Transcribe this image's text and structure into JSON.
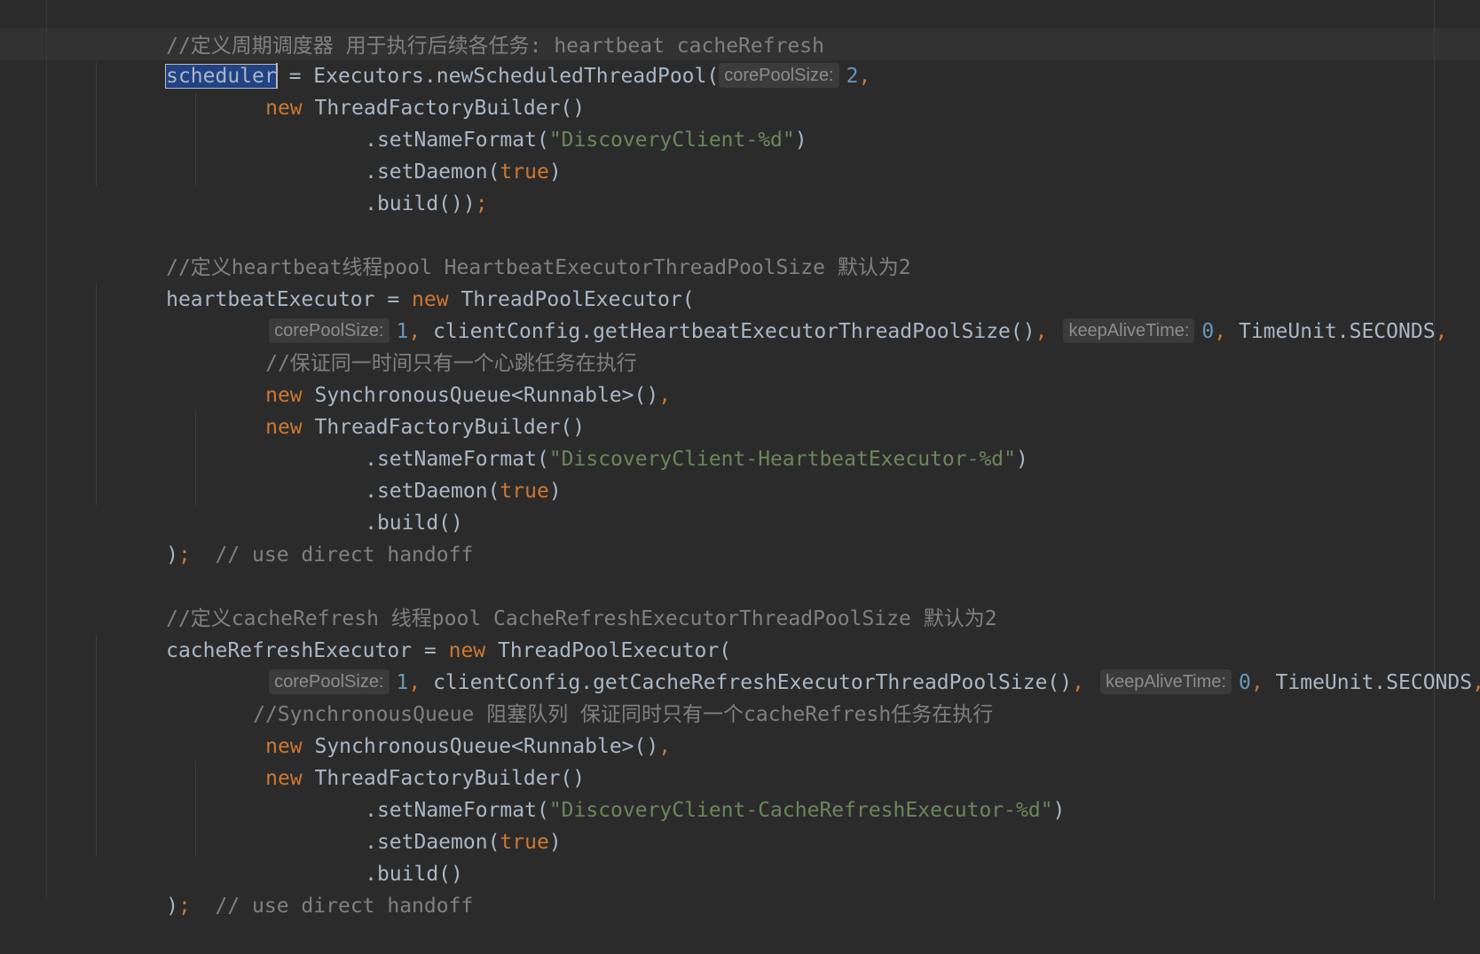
{
  "editor": {
    "lines": {
      "l1": {
        "comment": "//定义周期调度器 用于执行后续各任务: heartbeat cacheRefresh"
      },
      "l2": {
        "selected_word": "scheduler",
        "assign": " = Executors.newScheduledThreadPool(",
        "hint": "corePoolSize:",
        "arg": "2",
        "comma": ","
      },
      "l3": {
        "kw": "new",
        "text": " ThreadFactoryBuilder()"
      },
      "l4": {
        "text1": ".setNameFormat(",
        "str": "\"DiscoveryClient-%d\"",
        "text2": ")"
      },
      "l5": {
        "text1": ".setDaemon(",
        "kw": "true",
        "text2": ")"
      },
      "l6": {
        "text": ".build())",
        "semi": ";"
      },
      "l8": {
        "comment": "//定义heartbeat线程pool HeartbeatExecutorThreadPoolSize 默认为2"
      },
      "l9": {
        "text": "heartbeatExecutor = ",
        "kw": "new",
        "text2": " ThreadPoolExecutor("
      },
      "l10": {
        "hint1": "corePoolSize:",
        "num1": "1",
        "sep1": ",",
        "text": " clientConfig.getHeartbeatExecutorThreadPoolSize()",
        "sep2": ",",
        "hint2": "keepAliveTime:",
        "num2": "0",
        "sep3": ",",
        "text2": " TimeUnit.SECONDS",
        "sep4": ","
      },
      "l11": {
        "comment": "//保证同一时间只有一个心跳任务在执行"
      },
      "l12": {
        "kw": "new",
        "text": " SynchronousQueue<Runnable>()",
        "sep": ","
      },
      "l13": {
        "kw": "new",
        "text": " ThreadFactoryBuilder()"
      },
      "l14": {
        "text1": ".setNameFormat(",
        "str": "\"DiscoveryClient-HeartbeatExecutor-%d\"",
        "text2": ")"
      },
      "l15": {
        "text1": ".setDaemon(",
        "kw": "true",
        "text2": ")"
      },
      "l16": {
        "text": ".build()"
      },
      "l17": {
        "text": ")",
        "semi": ";",
        "comment": "  // use direct handoff"
      },
      "l19": {
        "comment": "//定义cacheRefresh 线程pool CacheRefreshExecutorThreadPoolSize 默认为2"
      },
      "l20": {
        "text": "cacheRefreshExecutor = ",
        "kw": "new",
        "text2": " ThreadPoolExecutor("
      },
      "l21": {
        "hint1": "corePoolSize:",
        "num1": "1",
        "sep1": ",",
        "text": " clientConfig.getCacheRefreshExecutorThreadPoolSize()",
        "sep2": ",",
        "hint2": "keepAliveTime:",
        "num2": "0",
        "sep3": ",",
        "text2": " TimeUnit.SECONDS",
        "sep4": ","
      },
      "l22": {
        "comment": "//SynchronousQueue 阻塞队列 保证同时只有一个cacheRefresh任务在执行"
      },
      "l23": {
        "kw": "new",
        "text": " SynchronousQueue<Runnable>()",
        "sep": ","
      },
      "l24": {
        "kw": "new",
        "text": " ThreadFactoryBuilder()"
      },
      "l25": {
        "text1": ".setNameFormat(",
        "str": "\"DiscoveryClient-CacheRefreshExecutor-%d\"",
        "text2": ")"
      },
      "l26": {
        "text1": ".setDaemon(",
        "kw": "true",
        "text2": ")"
      },
      "l27": {
        "text": ".build()"
      },
      "l28": {
        "text": ")",
        "semi": ";",
        "comment": "  // use direct handoff"
      }
    }
  }
}
